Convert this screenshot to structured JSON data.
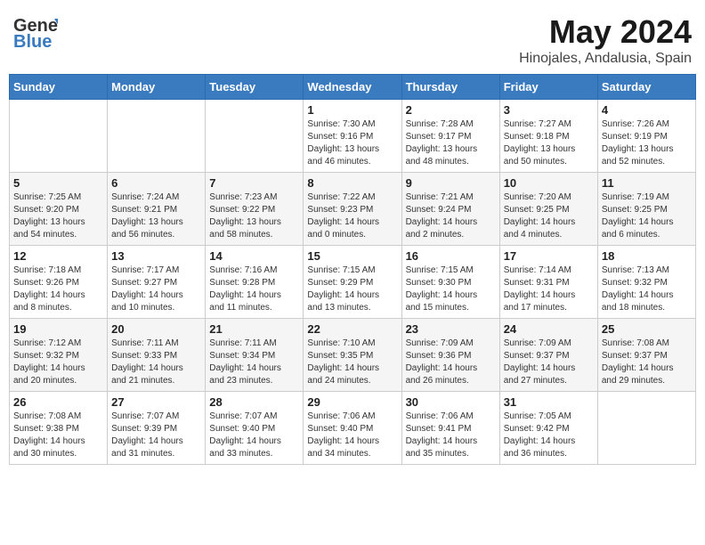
{
  "header": {
    "logo_general": "General",
    "logo_blue": "Blue",
    "month": "May 2024",
    "location": "Hinojales, Andalusia, Spain"
  },
  "days_of_week": [
    "Sunday",
    "Monday",
    "Tuesday",
    "Wednesday",
    "Thursday",
    "Friday",
    "Saturday"
  ],
  "weeks": [
    [
      {
        "day": "",
        "info": ""
      },
      {
        "day": "",
        "info": ""
      },
      {
        "day": "",
        "info": ""
      },
      {
        "day": "1",
        "info": "Sunrise: 7:30 AM\nSunset: 9:16 PM\nDaylight: 13 hours\nand 46 minutes."
      },
      {
        "day": "2",
        "info": "Sunrise: 7:28 AM\nSunset: 9:17 PM\nDaylight: 13 hours\nand 48 minutes."
      },
      {
        "day": "3",
        "info": "Sunrise: 7:27 AM\nSunset: 9:18 PM\nDaylight: 13 hours\nand 50 minutes."
      },
      {
        "day": "4",
        "info": "Sunrise: 7:26 AM\nSunset: 9:19 PM\nDaylight: 13 hours\nand 52 minutes."
      }
    ],
    [
      {
        "day": "5",
        "info": "Sunrise: 7:25 AM\nSunset: 9:20 PM\nDaylight: 13 hours\nand 54 minutes."
      },
      {
        "day": "6",
        "info": "Sunrise: 7:24 AM\nSunset: 9:21 PM\nDaylight: 13 hours\nand 56 minutes."
      },
      {
        "day": "7",
        "info": "Sunrise: 7:23 AM\nSunset: 9:22 PM\nDaylight: 13 hours\nand 58 minutes."
      },
      {
        "day": "8",
        "info": "Sunrise: 7:22 AM\nSunset: 9:23 PM\nDaylight: 14 hours\nand 0 minutes."
      },
      {
        "day": "9",
        "info": "Sunrise: 7:21 AM\nSunset: 9:24 PM\nDaylight: 14 hours\nand 2 minutes."
      },
      {
        "day": "10",
        "info": "Sunrise: 7:20 AM\nSunset: 9:25 PM\nDaylight: 14 hours\nand 4 minutes."
      },
      {
        "day": "11",
        "info": "Sunrise: 7:19 AM\nSunset: 9:25 PM\nDaylight: 14 hours\nand 6 minutes."
      }
    ],
    [
      {
        "day": "12",
        "info": "Sunrise: 7:18 AM\nSunset: 9:26 PM\nDaylight: 14 hours\nand 8 minutes."
      },
      {
        "day": "13",
        "info": "Sunrise: 7:17 AM\nSunset: 9:27 PM\nDaylight: 14 hours\nand 10 minutes."
      },
      {
        "day": "14",
        "info": "Sunrise: 7:16 AM\nSunset: 9:28 PM\nDaylight: 14 hours\nand 11 minutes."
      },
      {
        "day": "15",
        "info": "Sunrise: 7:15 AM\nSunset: 9:29 PM\nDaylight: 14 hours\nand 13 minutes."
      },
      {
        "day": "16",
        "info": "Sunrise: 7:15 AM\nSunset: 9:30 PM\nDaylight: 14 hours\nand 15 minutes."
      },
      {
        "day": "17",
        "info": "Sunrise: 7:14 AM\nSunset: 9:31 PM\nDaylight: 14 hours\nand 17 minutes."
      },
      {
        "day": "18",
        "info": "Sunrise: 7:13 AM\nSunset: 9:32 PM\nDaylight: 14 hours\nand 18 minutes."
      }
    ],
    [
      {
        "day": "19",
        "info": "Sunrise: 7:12 AM\nSunset: 9:32 PM\nDaylight: 14 hours\nand 20 minutes."
      },
      {
        "day": "20",
        "info": "Sunrise: 7:11 AM\nSunset: 9:33 PM\nDaylight: 14 hours\nand 21 minutes."
      },
      {
        "day": "21",
        "info": "Sunrise: 7:11 AM\nSunset: 9:34 PM\nDaylight: 14 hours\nand 23 minutes."
      },
      {
        "day": "22",
        "info": "Sunrise: 7:10 AM\nSunset: 9:35 PM\nDaylight: 14 hours\nand 24 minutes."
      },
      {
        "day": "23",
        "info": "Sunrise: 7:09 AM\nSunset: 9:36 PM\nDaylight: 14 hours\nand 26 minutes."
      },
      {
        "day": "24",
        "info": "Sunrise: 7:09 AM\nSunset: 9:37 PM\nDaylight: 14 hours\nand 27 minutes."
      },
      {
        "day": "25",
        "info": "Sunrise: 7:08 AM\nSunset: 9:37 PM\nDaylight: 14 hours\nand 29 minutes."
      }
    ],
    [
      {
        "day": "26",
        "info": "Sunrise: 7:08 AM\nSunset: 9:38 PM\nDaylight: 14 hours\nand 30 minutes."
      },
      {
        "day": "27",
        "info": "Sunrise: 7:07 AM\nSunset: 9:39 PM\nDaylight: 14 hours\nand 31 minutes."
      },
      {
        "day": "28",
        "info": "Sunrise: 7:07 AM\nSunset: 9:40 PM\nDaylight: 14 hours\nand 33 minutes."
      },
      {
        "day": "29",
        "info": "Sunrise: 7:06 AM\nSunset: 9:40 PM\nDaylight: 14 hours\nand 34 minutes."
      },
      {
        "day": "30",
        "info": "Sunrise: 7:06 AM\nSunset: 9:41 PM\nDaylight: 14 hours\nand 35 minutes."
      },
      {
        "day": "31",
        "info": "Sunrise: 7:05 AM\nSunset: 9:42 PM\nDaylight: 14 hours\nand 36 minutes."
      },
      {
        "day": "",
        "info": ""
      }
    ]
  ]
}
